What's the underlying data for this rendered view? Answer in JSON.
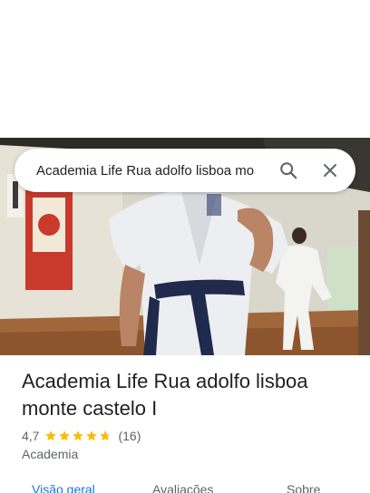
{
  "search": {
    "query": "Academia Life Rua adolfo lisboa mo"
  },
  "place": {
    "title": "Academia Life Rua adolfo lisboa monte castelo I",
    "rating": "4,7",
    "rating_value": 4.7,
    "rating_max": 5,
    "review_count": "(16)",
    "category": "Academia"
  },
  "tabs": [
    {
      "label": "Visão geral",
      "active": true
    },
    {
      "label": "Avaliações",
      "active": false
    },
    {
      "label": "Sobre",
      "active": false
    }
  ],
  "icons": {
    "search": "search-icon",
    "close": "close-icon",
    "star": "star-icon"
  },
  "colors": {
    "accent": "#1a73e8",
    "star": "#fbbc04",
    "text_primary": "#202124",
    "text_secondary": "#5f6368"
  }
}
